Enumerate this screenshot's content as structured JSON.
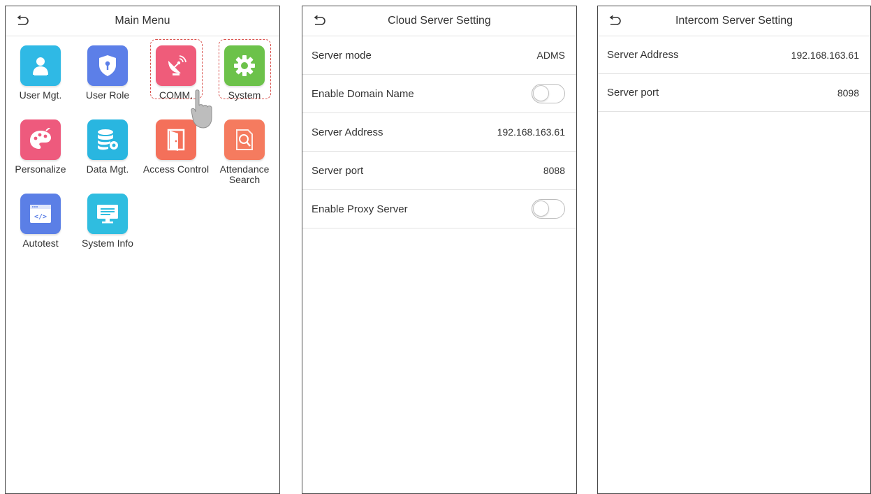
{
  "main_menu": {
    "title": "Main Menu",
    "tiles": [
      {
        "label": "User Mgt.",
        "icon": "user-icon",
        "color": "#2fb9e5"
      },
      {
        "label": "User Role",
        "icon": "shield-icon",
        "color": "#5c7fe8"
      },
      {
        "label": "COMM.",
        "icon": "satellite-dish-icon",
        "color": "#ef5c7a"
      },
      {
        "label": "System",
        "icon": "gear-icon",
        "color": "#6cc24a"
      },
      {
        "label": "Personalize",
        "icon": "palette-icon",
        "color": "#ee5a7d"
      },
      {
        "label": "Data Mgt.",
        "icon": "database-gear-icon",
        "color": "#29b6e0"
      },
      {
        "label": "Access Control",
        "icon": "door-icon",
        "color": "#f4705a"
      },
      {
        "label": "Attendance\nSearch",
        "icon": "search-document-icon",
        "color": "#f57b5f"
      },
      {
        "label": "Autotest",
        "icon": "code-window-icon",
        "color": "#5b7fe6"
      },
      {
        "label": "System Info",
        "icon": "monitor-icon",
        "color": "#2fbde0"
      }
    ]
  },
  "cloud_server": {
    "title": "Cloud Server Setting",
    "rows": [
      {
        "label": "Server mode",
        "value": "ADMS"
      },
      {
        "label": "Enable Domain Name",
        "toggle": false
      },
      {
        "label": "Server Address",
        "value": "192.168.163.61"
      },
      {
        "label": "Server port",
        "value": "8088"
      },
      {
        "label": "Enable Proxy Server",
        "toggle": false
      }
    ]
  },
  "intercom_server": {
    "title": "Intercom Server Setting",
    "rows": [
      {
        "label": "Server Address",
        "value": "192.168.163.61"
      },
      {
        "label": "Server port",
        "value": "8098"
      }
    ]
  }
}
